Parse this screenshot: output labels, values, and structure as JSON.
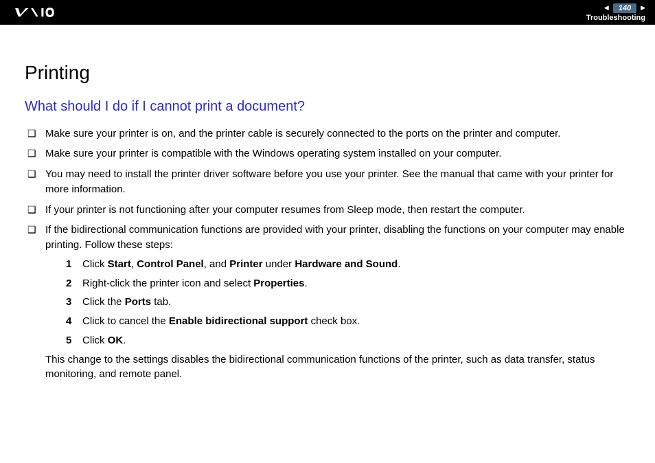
{
  "header": {
    "page_number": "140",
    "section": "Troubleshooting"
  },
  "title": "Printing",
  "question": "What should I do if I cannot print a document?",
  "bullets": [
    "Make sure your printer is on, and the printer cable is securely connected to the ports on the printer and computer.",
    "Make sure your printer is compatible with the Windows operating system installed on your computer.",
    "You may need to install the printer driver software before you use your printer. See the manual that came with your printer for more information.",
    "If your printer is not functioning after your computer resumes from Sleep mode, then restart the computer.",
    "If the bidirectional communication functions are provided with your printer, disabling the functions on your computer may enable printing. Follow these steps:"
  ],
  "steps": [
    {
      "num": "1",
      "prefix": "Click ",
      "bold1": "Start",
      "mid1": ", ",
      "bold2": "Control Panel",
      "mid2": ", and ",
      "bold3": "Printer",
      "mid3": " under ",
      "bold4": "Hardware and Sound",
      "suffix": "."
    },
    {
      "num": "2",
      "prefix": "Right-click the printer icon and select ",
      "bold1": "Properties",
      "suffix": "."
    },
    {
      "num": "3",
      "prefix": "Click the ",
      "bold1": "Ports",
      "suffix": " tab."
    },
    {
      "num": "4",
      "prefix": "Click to cancel the ",
      "bold1": "Enable bidirectional support",
      "suffix": " check box."
    },
    {
      "num": "5",
      "prefix": "Click ",
      "bold1": "OK",
      "suffix": "."
    }
  ],
  "closing": "This change to the settings disables the bidirectional communication functions of the printer, such as data transfer, status monitoring, and remote panel."
}
